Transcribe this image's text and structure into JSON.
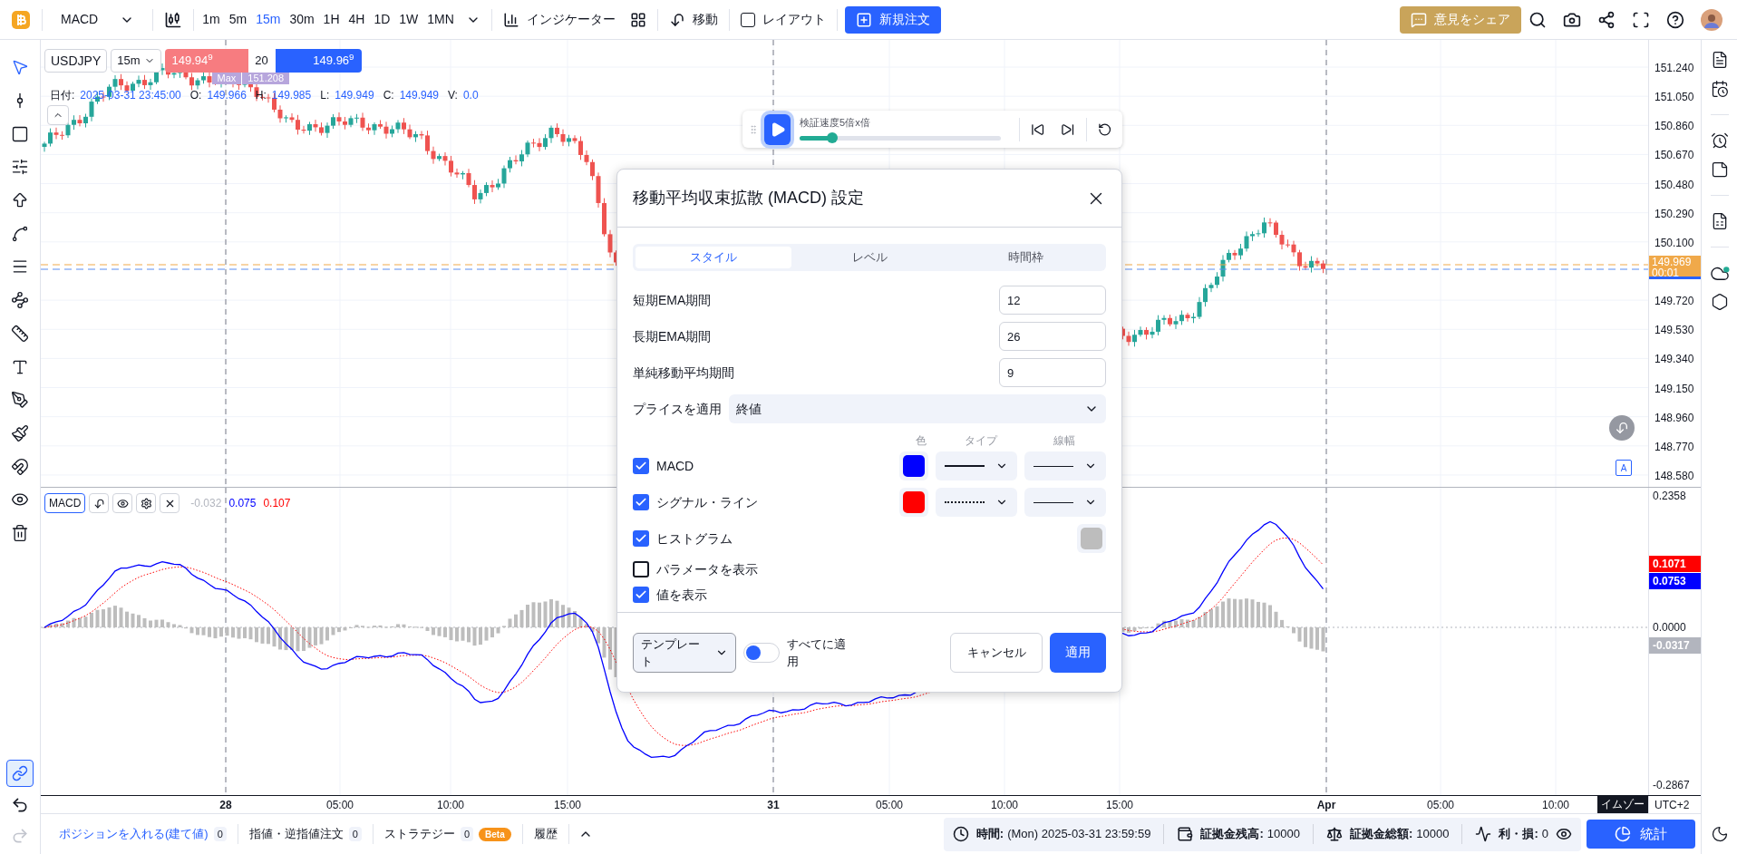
{
  "toolbar": {
    "symbol": "MACD",
    "timeframes": [
      {
        "label": "1m",
        "selected": false
      },
      {
        "label": "5m",
        "selected": false
      },
      {
        "label": "15m",
        "selected": true
      },
      {
        "label": "30m",
        "selected": false
      },
      {
        "label": "1H",
        "selected": false
      },
      {
        "label": "4H",
        "selected": false
      },
      {
        "label": "1D",
        "selected": false
      },
      {
        "label": "1W",
        "selected": false
      },
      {
        "label": "1MN",
        "selected": false
      }
    ],
    "indicators": "インジケーター",
    "replay": "移動",
    "layout": {
      "label": "レイアウト",
      "checked": false
    },
    "new_order": "新規注文",
    "feedback": "意見をシェア"
  },
  "chart": {
    "symbol": "USDJPY",
    "interval": "15m",
    "sell_price": "149.94$^{9}$",
    "quantity": "20",
    "buy_price": "149.96$^{9}$",
    "max_marker": {
      "label": "Max",
      "value": "151.208"
    },
    "ohlc": [
      {
        "label": "日付:",
        "value": "2025-03-31 23:45:00"
      },
      {
        "label": "O:",
        "value": "149.966"
      },
      {
        "label": "H:",
        "value": "149.985"
      },
      {
        "label": "L:",
        "value": "149.949"
      },
      {
        "label": "C:",
        "value": "149.949"
      },
      {
        "label": "V:",
        "value": "0.0"
      }
    ],
    "autoscale": "A"
  },
  "price_axis": {
    "labels": [
      "151.240",
      "151.050",
      "150.860",
      "150.670",
      "150.480",
      "150.290",
      "150.100",
      "149.720",
      "149.530",
      "149.340",
      "149.150",
      "148.960",
      "148.770",
      "148.580"
    ],
    "current_price": "149.969",
    "countdown": "00:01"
  },
  "replay_bar": {
    "speed_label": "検証速度5倍x倍",
    "level": 0.16
  },
  "dialog": {
    "title": "移動平均収束拡散 (MACD) 設定",
    "tabs": [
      {
        "label": "スタイル",
        "selected": true
      },
      {
        "label": "レベル",
        "selected": false
      },
      {
        "label": "時間枠",
        "selected": false
      }
    ],
    "inputs": [
      {
        "label": "短期EMA期間",
        "value": "12"
      },
      {
        "label": "長期EMA期間",
        "value": "26"
      },
      {
        "label": "単純移動平均期間",
        "value": "9"
      }
    ],
    "price_source": {
      "label": "プライスを適用",
      "value": "終値"
    },
    "columns": [
      "色",
      "タイプ",
      "線幅"
    ],
    "plots": [
      {
        "label": "MACD",
        "checked": true,
        "color": "#0000ff",
        "kind": "solid"
      },
      {
        "label": "シグナル・ライン",
        "checked": true,
        "color": "#ff0000",
        "kind": "dotted"
      },
      {
        "label": "ヒストグラム",
        "checked": true,
        "color": "#bdbdbd",
        "kind": "fill"
      }
    ],
    "options": [
      {
        "label": "パラメータを表示",
        "checked": false
      },
      {
        "label": "値を表示",
        "checked": true
      }
    ],
    "template": "テンプレート",
    "apply_all": {
      "label": "すべてに適用",
      "on": false
    },
    "cancel": "キャンセル",
    "apply": "適用"
  },
  "macd_pane": {
    "label": "MACD",
    "values": [
      {
        "text": "-0.032",
        "color": "#b2b5be"
      },
      {
        "text": "0.075",
        "color": "#0000ff"
      },
      {
        "text": "0.107",
        "color": "#ff0000"
      }
    ],
    "axis": [
      {
        "kind": "label",
        "text": "0.2358"
      },
      {
        "kind": "tag",
        "text": "0.1071",
        "color": "#ff0000"
      },
      {
        "kind": "tag",
        "text": "0.0753",
        "color": "#0000ff"
      },
      {
        "kind": "label",
        "text": "0.0000"
      },
      {
        "kind": "tag",
        "text": "-0.0317",
        "color": "#b2b5be"
      },
      {
        "kind": "label",
        "text": "-0.2867"
      }
    ]
  },
  "time_axis": {
    "labels": [
      {
        "text": "28",
        "kind": "day"
      },
      {
        "text": "05:00",
        "kind": "time"
      },
      {
        "text": "10:00",
        "kind": "time"
      },
      {
        "text": "15:00",
        "kind": "time"
      },
      {
        "text": "31",
        "kind": "day"
      },
      {
        "text": "05:00",
        "kind": "time"
      },
      {
        "text": "10:00",
        "kind": "time"
      },
      {
        "text": "15:00",
        "kind": "time"
      },
      {
        "text": "Apr",
        "kind": "day"
      },
      {
        "text": "05:00",
        "kind": "time"
      },
      {
        "text": "10:00",
        "kind": "time"
      }
    ],
    "tooltip": "イムゾー",
    "timezone": "UTC+2"
  },
  "bottom_bar": {
    "tabs": [
      {
        "label": "ポジションを入れる(建て値)",
        "count": "0",
        "selected": true
      },
      {
        "label": "指値・逆指値注文",
        "count": "0",
        "selected": false
      },
      {
        "label": "ストラテジー",
        "count": "0",
        "badge": "Beta",
        "selected": false
      },
      {
        "label": "履歴",
        "selected": false
      }
    ],
    "stats": [
      {
        "kind": "time",
        "label": "時間:",
        "value": "(Mon) 2025-03-31 23:59:59"
      },
      {
        "kind": "balance",
        "label": "証拠金残高:",
        "value": "10000"
      },
      {
        "kind": "equity",
        "label": "証拠金総額:",
        "value": "10000"
      },
      {
        "kind": "pnl",
        "label": "利・損:",
        "value": "0"
      }
    ],
    "stats_button": "統計"
  }
}
